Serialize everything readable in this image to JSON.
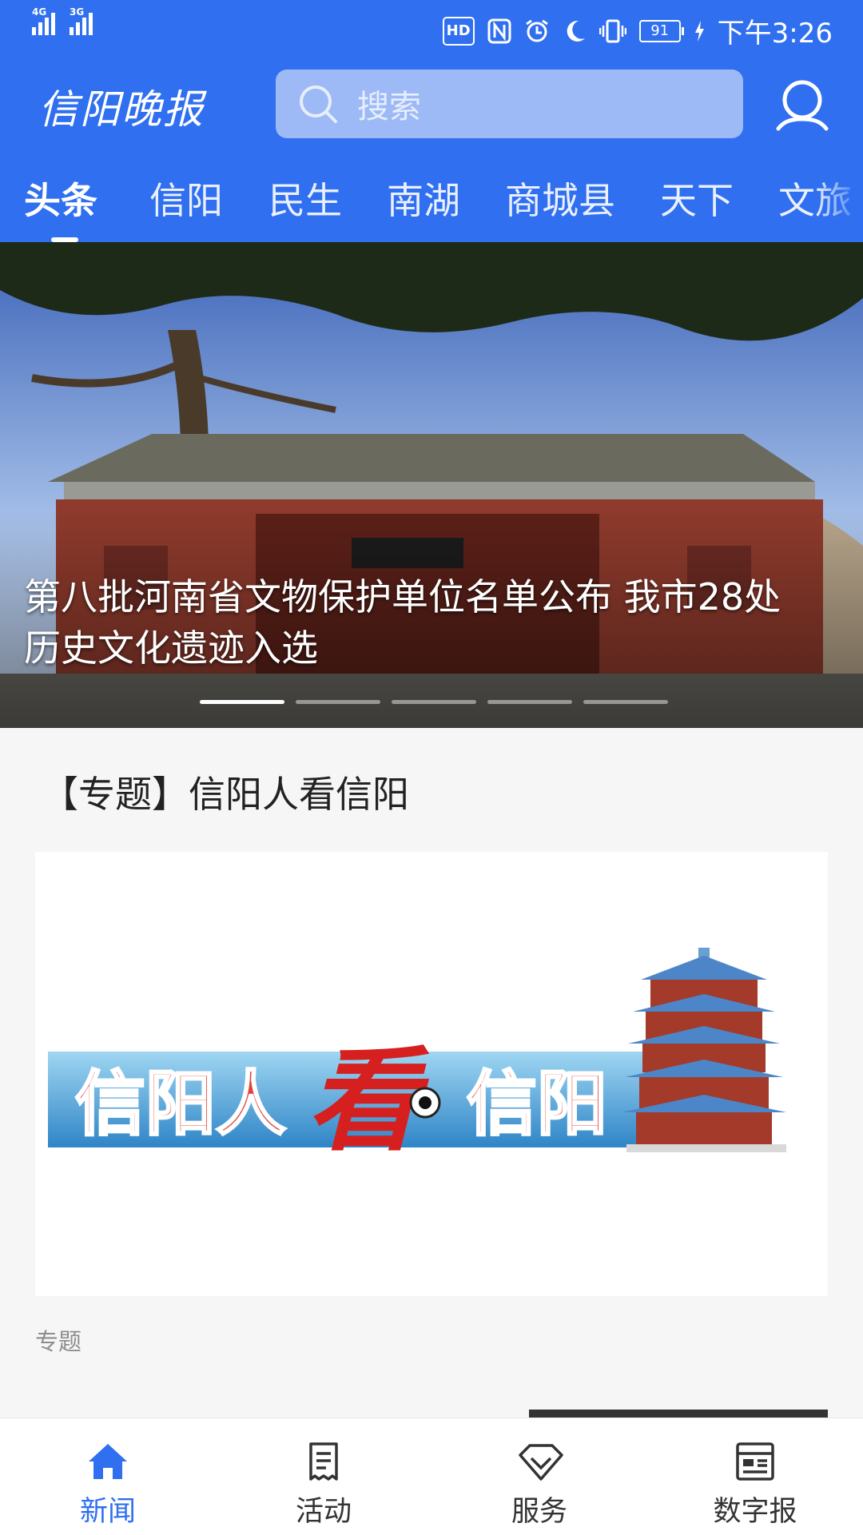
{
  "status_bar": {
    "net1": "4G",
    "net2": "3G",
    "hd": "HD",
    "battery": "91",
    "time": "下午3:26",
    "icons": [
      "signal-icon",
      "nfc-icon",
      "alarm-icon",
      "moon-icon",
      "vibrate-icon",
      "battery-icon",
      "charging-icon"
    ]
  },
  "header": {
    "logo_text": "信阳晚报",
    "search_placeholder": "搜索"
  },
  "tabs": [
    {
      "label": "头条",
      "active": true
    },
    {
      "label": "信阳"
    },
    {
      "label": "民生"
    },
    {
      "label": "南湖"
    },
    {
      "label": "商城县"
    },
    {
      "label": "天下"
    },
    {
      "label": "文旅"
    }
  ],
  "banner": {
    "caption": "第八批河南省文物保护单位名单公布 我市28处历史文化遗迹入选",
    "slide_count": 5,
    "active_slide": 1
  },
  "section": {
    "title": "【专题】信阳人看信阳",
    "card_image_text": {
      "part1": "信阳人",
      "part2": "看",
      "part3": "信阳"
    },
    "tag": "专题"
  },
  "bottom_nav": [
    {
      "label": "新闻",
      "icon": "home-icon",
      "active": true
    },
    {
      "label": "活动",
      "icon": "receipt-icon"
    },
    {
      "label": "服务",
      "icon": "diamond-icon"
    },
    {
      "label": "数字报",
      "icon": "newspaper-icon"
    }
  ],
  "colors": {
    "brand_blue": "#2f6ff0",
    "search_bg": "#9dbaf7"
  }
}
